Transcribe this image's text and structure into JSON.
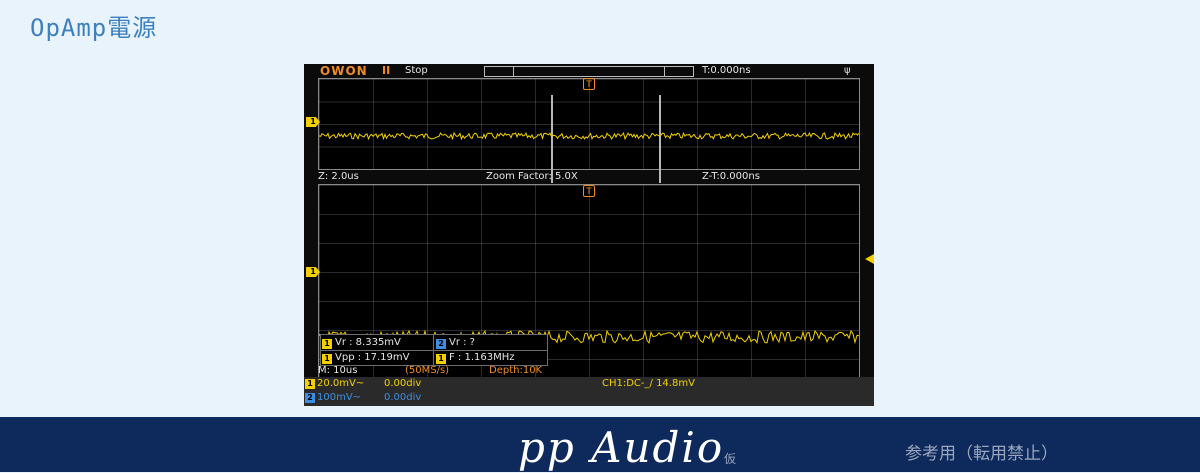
{
  "page": {
    "title": "OpAmp電源"
  },
  "scope": {
    "brand": "OWON",
    "run_icon": "II",
    "run_state": "Stop",
    "trigger_position": "T:0.000ns",
    "usb_icon": "usb-icon",
    "trigger_marker": "T",
    "zoom": {
      "scale": "Z: 2.0us",
      "factor": "Zoom Factor: 5.0X",
      "offset": "Z-T:0.000ns"
    },
    "channel_marker": "1",
    "measurements": [
      {
        "channel": "1",
        "text": "Vr : 8.335mV"
      },
      {
        "channel": "2",
        "text": "Vr :     ?"
      },
      {
        "channel": "1",
        "text": "Vpp : 17.19mV"
      },
      {
        "channel": "1",
        "text": "F : 1.163MHz"
      }
    ],
    "timebase": "M: 10us",
    "sample_rate": "(50MS/s)",
    "depth": "Depth:10K",
    "channels": [
      {
        "id": "1",
        "scale": "20.0mV~",
        "position": "0.00div",
        "color": "#f4d000"
      },
      {
        "id": "2",
        "scale": "100mV~",
        "position": "0.00div",
        "color": "#3f8de0"
      }
    ],
    "trigger_info": "CH1:DC-_/ 14.8mV",
    "trace_color": "#f4d000"
  },
  "footer": {
    "logo": "pp Audio",
    "logo_sub": "仮",
    "note": "参考用（転用禁止）"
  }
}
